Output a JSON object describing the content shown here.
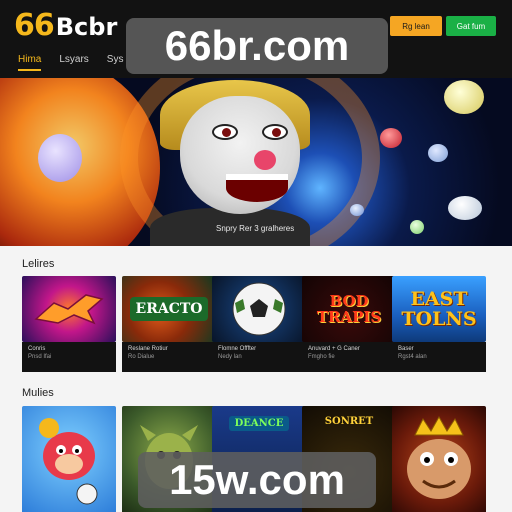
{
  "header": {
    "logo_number": "66",
    "logo_text": "Bcbr",
    "login_label": "Rg lean",
    "register_label": "Gat fum",
    "nav": [
      "Hima",
      "Lsyars",
      "Sys"
    ]
  },
  "watermarks": {
    "top": "66br.com",
    "bottom": "15w.com"
  },
  "banner": {
    "caption": "Snpry Rer 3 gralheres"
  },
  "sections": [
    {
      "title": "Lelires",
      "tiles": [
        {
          "art_text": "",
          "line1": "Conris",
          "line2": "Pnsd Ifai",
          "color": "#3b1a7a"
        },
        {
          "art_text": "ERACTO",
          "line1": "Reslane Rotiur",
          "line2": "Ro Dialue",
          "color": "#0e5a3a"
        },
        {
          "art_text": "",
          "line1": "Flomne Offfter",
          "line2": "Nedy lan",
          "color": "#0d1a3a"
        },
        {
          "art_text": "BOD TRAPIS",
          "line1": "Anuvard + G Caner",
          "line2": "Fmgho fie",
          "color": "#7a1508"
        },
        {
          "art_text": "EAST TOLNS",
          "line1": "Baser",
          "line2": "Rgst4 alan",
          "color": "#1b6fd1"
        }
      ]
    },
    {
      "title": "Mulies",
      "tiles": [
        {
          "art_text": "",
          "color": "#3a8fe0"
        },
        {
          "art_text": "",
          "color": "#3b5a2a"
        },
        {
          "art_text": "DEANCE",
          "color": "#0b1f4a"
        },
        {
          "art_text": "SONRET",
          "color": "#1a1208"
        },
        {
          "art_text": "",
          "color": "#6a1a0a"
        }
      ]
    }
  ]
}
